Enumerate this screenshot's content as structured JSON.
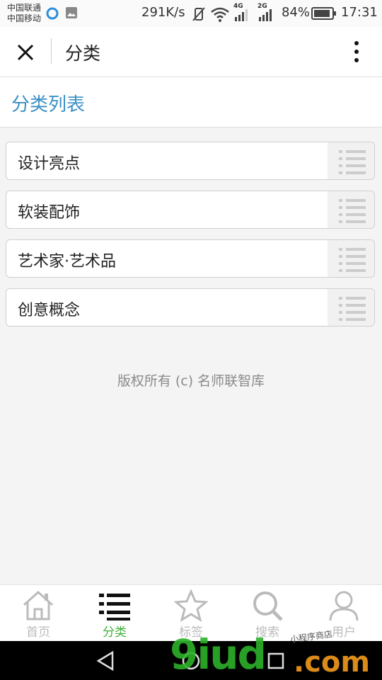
{
  "status_bar": {
    "carrier1": "中国联通",
    "carrier2": "中国移动",
    "speed": "291K/s",
    "net1": "4G",
    "net2": "2G",
    "battery": "84%",
    "time": "17:31"
  },
  "header": {
    "title": "分类"
  },
  "section": {
    "title": "分类列表"
  },
  "categories": [
    {
      "label": "设计亮点"
    },
    {
      "label": "软装配饰"
    },
    {
      "label": "艺术家·艺术品"
    },
    {
      "label": "创意概念"
    }
  ],
  "footer": {
    "copyright": "版权所有 (c) 名师联智库"
  },
  "tabs": [
    {
      "label": "首页",
      "icon": "home-icon"
    },
    {
      "label": "分类",
      "icon": "list-icon",
      "active": true
    },
    {
      "label": "标签",
      "icon": "star-icon"
    },
    {
      "label": "搜索",
      "icon": "search-icon"
    },
    {
      "label": "用户",
      "icon": "user-icon"
    }
  ],
  "watermark": {
    "text": "9iud",
    "suffix": ".com",
    "small": "小程序商店"
  },
  "colors": {
    "accent_blue": "#3a8fc4",
    "active_green": "#3fb13a",
    "inactive_gray": "#bbbbbb"
  }
}
